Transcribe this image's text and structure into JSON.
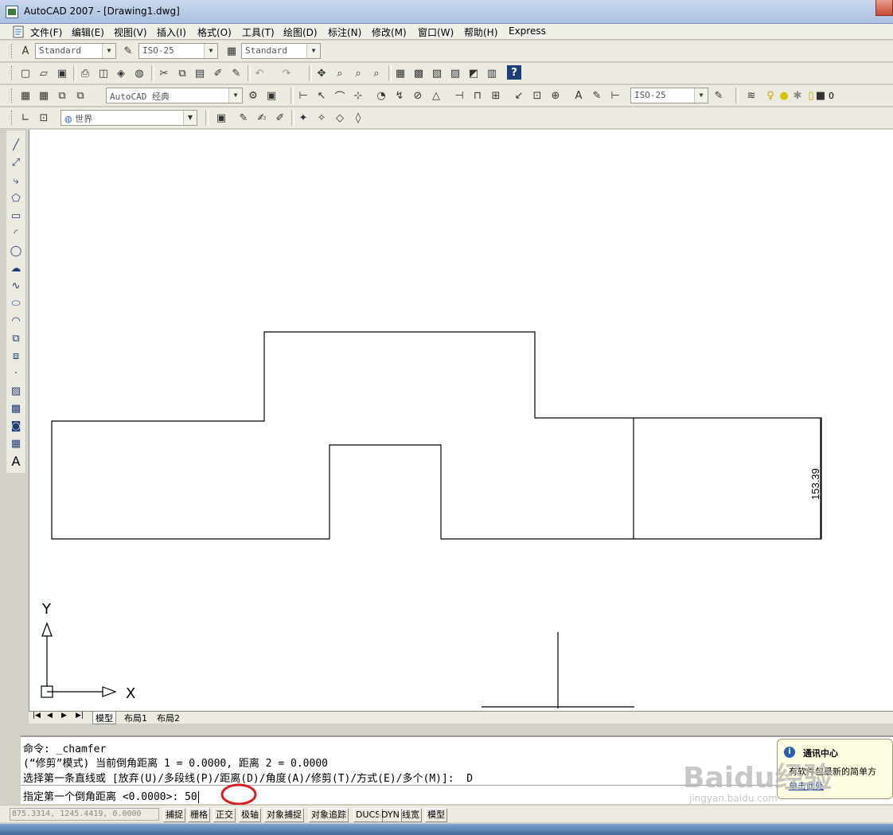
{
  "window": {
    "title": "AutoCAD 2007 - [Drawing1.dwg]"
  },
  "menu": [
    "文件(F)",
    "编辑(E)",
    "视图(V)",
    "插入(I)",
    "格式(O)",
    "工具(T)",
    "绘图(D)",
    "标注(N)",
    "修改(M)",
    "窗口(W)",
    "帮助(H)",
    "Express"
  ],
  "toolbar1": {
    "text_style": "Standard",
    "dim_style": "ISO-25",
    "table_style": "Standard"
  },
  "toolbar3": {
    "workspace": "AutoCAD 经典",
    "dim_style2": "ISO-25",
    "layer": "0"
  },
  "toolbar4": {
    "ucs": "世界"
  },
  "canvas": {
    "dimension_text": "153.39",
    "ucs_x": "X",
    "ucs_y": "Y"
  },
  "layout_tabs": [
    "模型",
    "布局1",
    "布局2"
  ],
  "command": {
    "line1": "命令: _chamfer",
    "line2": "(“修剪”模式) 当前倒角距离 1 = 0.0000, 距离 2 = 0.0000",
    "line3": "选择第一条直线或 [放弃(U)/多段线(P)/距离(D)/角度(A)/修剪(T)/方式(E)/多个(M)]:  D",
    "prompt": "指定第一个倒角距离 <0.0000>: ",
    "input": "50",
    "highlight_color": "#d42020"
  },
  "status": {
    "coords": "875.3314, 1245.4419, 0.0000",
    "buttons": [
      "捕捉",
      "栅格",
      "正交",
      "极轴",
      "对象捕捉",
      "对象追踪",
      "DUCS",
      "DYN",
      "线宽",
      "模型"
    ]
  },
  "notification": {
    "title": "通讯中心",
    "body": "有软件包最新的简单方",
    "link": "单击此处"
  },
  "watermark": {
    "brand": "Baidu经验",
    "url": "jingyan.baidu.com"
  }
}
